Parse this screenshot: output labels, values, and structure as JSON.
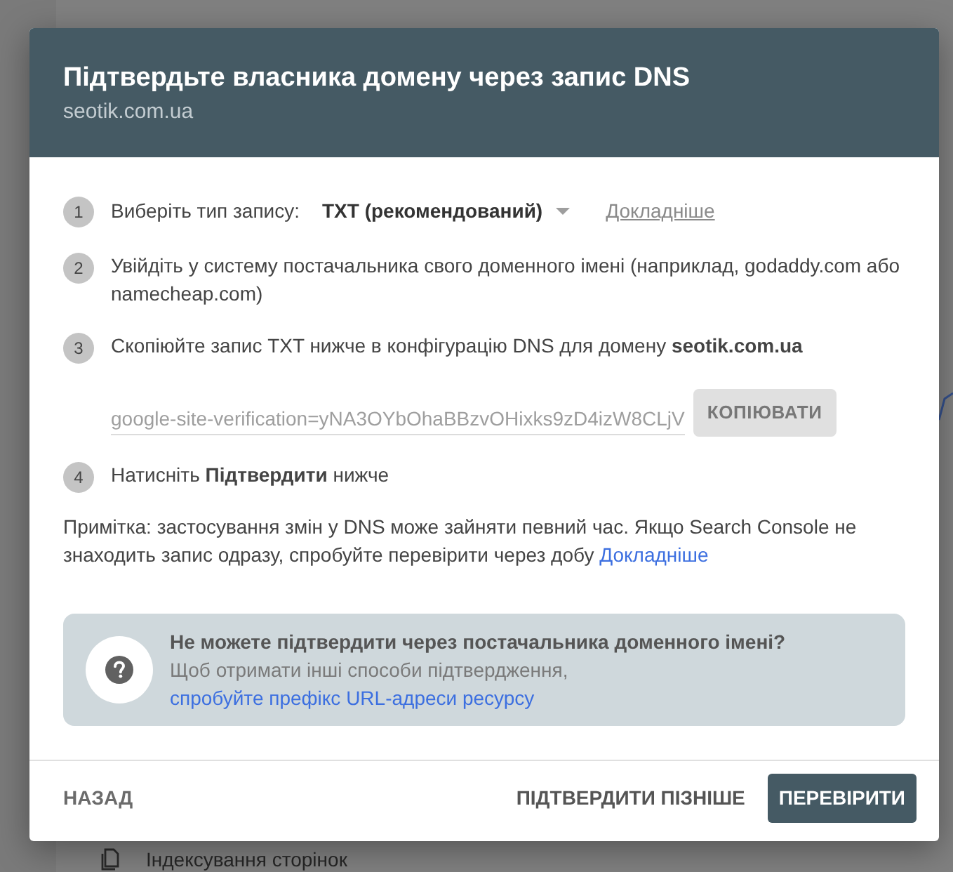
{
  "background": {
    "nav_item": "Індексування сторінок"
  },
  "dialog": {
    "title": "Підтвердьте власника домену через запис DNS",
    "subtitle": "seotik.com.ua"
  },
  "steps": [
    {
      "number": "1",
      "kind": "select",
      "label": "Виберіть тип запису:",
      "value": "TXT (рекомендований)",
      "link": "Докладніше"
    },
    {
      "number": "2",
      "kind": "text",
      "text": "Увійдіть у систему постачальника свого доменного імені (наприклад, godaddy.com або namecheap.com)"
    },
    {
      "number": "3",
      "kind": "copy",
      "text": "Скопіюйте запис TXT нижче в конфігурацію DNS для домену **seotik.com.ua**",
      "record": "google-site-verification=yNA3OYbOhaBBzvOHixks9zD4izW8CLjV",
      "button": "КОПІЮВАТИ"
    },
    {
      "number": "4",
      "kind": "text",
      "text": "Натисніть **Підтвердити** нижче"
    }
  ],
  "note": {
    "text": "Примітка: застосування змін у DNS може зайняти певний час. Якщо Search Console не знаходить запис одразу, спробуйте перевірити через добу",
    "link": "Докладніше"
  },
  "help_box": {
    "title": "Не можете підтвердити через постачальника доменного імені?",
    "text": "Щоб отримати інші способи підтвердження,",
    "link": "спробуйте префікс URL-адреси ресурсу"
  },
  "footer": {
    "back_button": "НАЗАД",
    "buttons": [
      {
        "label": "ПІДТВЕРДИТИ ПІЗНІШЕ",
        "kind": "text"
      },
      {
        "label": "ПЕРЕВІРИТИ",
        "kind": "primary"
      }
    ]
  }
}
